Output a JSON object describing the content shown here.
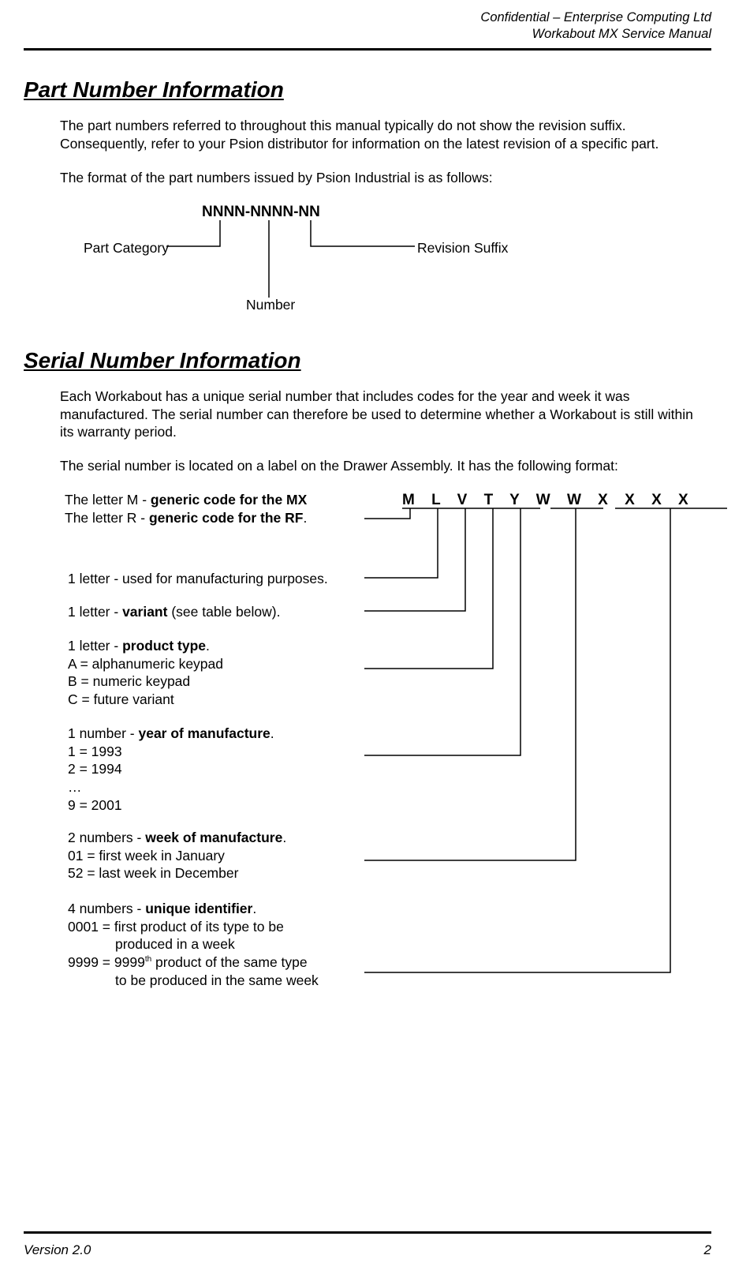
{
  "header": {
    "line1": "Confidential – Enterprise Computing Ltd",
    "line2": "Workabout MX Service Manual"
  },
  "section1": {
    "title": "Part Number Information",
    "p1": "The part numbers referred to throughout this manual typically do not show the revision suffix. Consequently, refer to your Psion distributor for information on the latest revision of a specific part.",
    "p2": "The format of the part numbers issued by Psion Industrial is as follows:",
    "format": "NNNN-NNNN-NN",
    "label_category": "Part Category",
    "label_number": "Number",
    "label_revision": "Revision Suffix"
  },
  "section2": {
    "title": "Serial Number Information",
    "p1": "Each Workabout has a unique serial number that includes codes for the year and week it was manufactured. The serial number can therefore be used to determine whether a Workabout is still within its warranty period.",
    "p2": "The serial number is located on a label on the Drawer Assembly. It has the following format:",
    "letters": "M L V T Y W W X X X X",
    "desc": {
      "m1_pre": "The letter M - ",
      "m1_bold": "generic code for the MX",
      "m2_pre": "The letter R - ",
      "m2_bold": "generic code for the RF",
      "mfg": "1 letter - used for manufacturing purposes.",
      "var_pre": "1 letter - ",
      "var_bold": "variant",
      "var_post": " (see table below).",
      "pt_pre": "1 letter - ",
      "pt_bold": "product type",
      "pt_a": "A = alphanumeric keypad",
      "pt_b": "B = numeric keypad",
      "pt_c": "C = future variant",
      "yr_pre": "1 number - ",
      "yr_bold": "year of manufacture",
      "yr_1": "1 = 1993",
      "yr_2": "2 = 1994",
      "yr_dots": "…",
      "yr_9": "9 = 2001",
      "wk_pre": "2 numbers - ",
      "wk_bold": "week of manufacture",
      "wk_1": "01 = first week in January",
      "wk_2": "52 = last week in December",
      "id_pre": "4 numbers - ",
      "id_bold": "unique identifier",
      "id_1a": "0001 = first product of its type to be",
      "id_1b": "produced in a week",
      "id_2a": "9999 = 9999",
      "id_2sup": "th",
      "id_2b": " product of the same type",
      "id_2c": "to be produced in the same week"
    }
  },
  "footer": {
    "version": "Version 2.0",
    "page": "2"
  },
  "punct": {
    "period": "."
  }
}
